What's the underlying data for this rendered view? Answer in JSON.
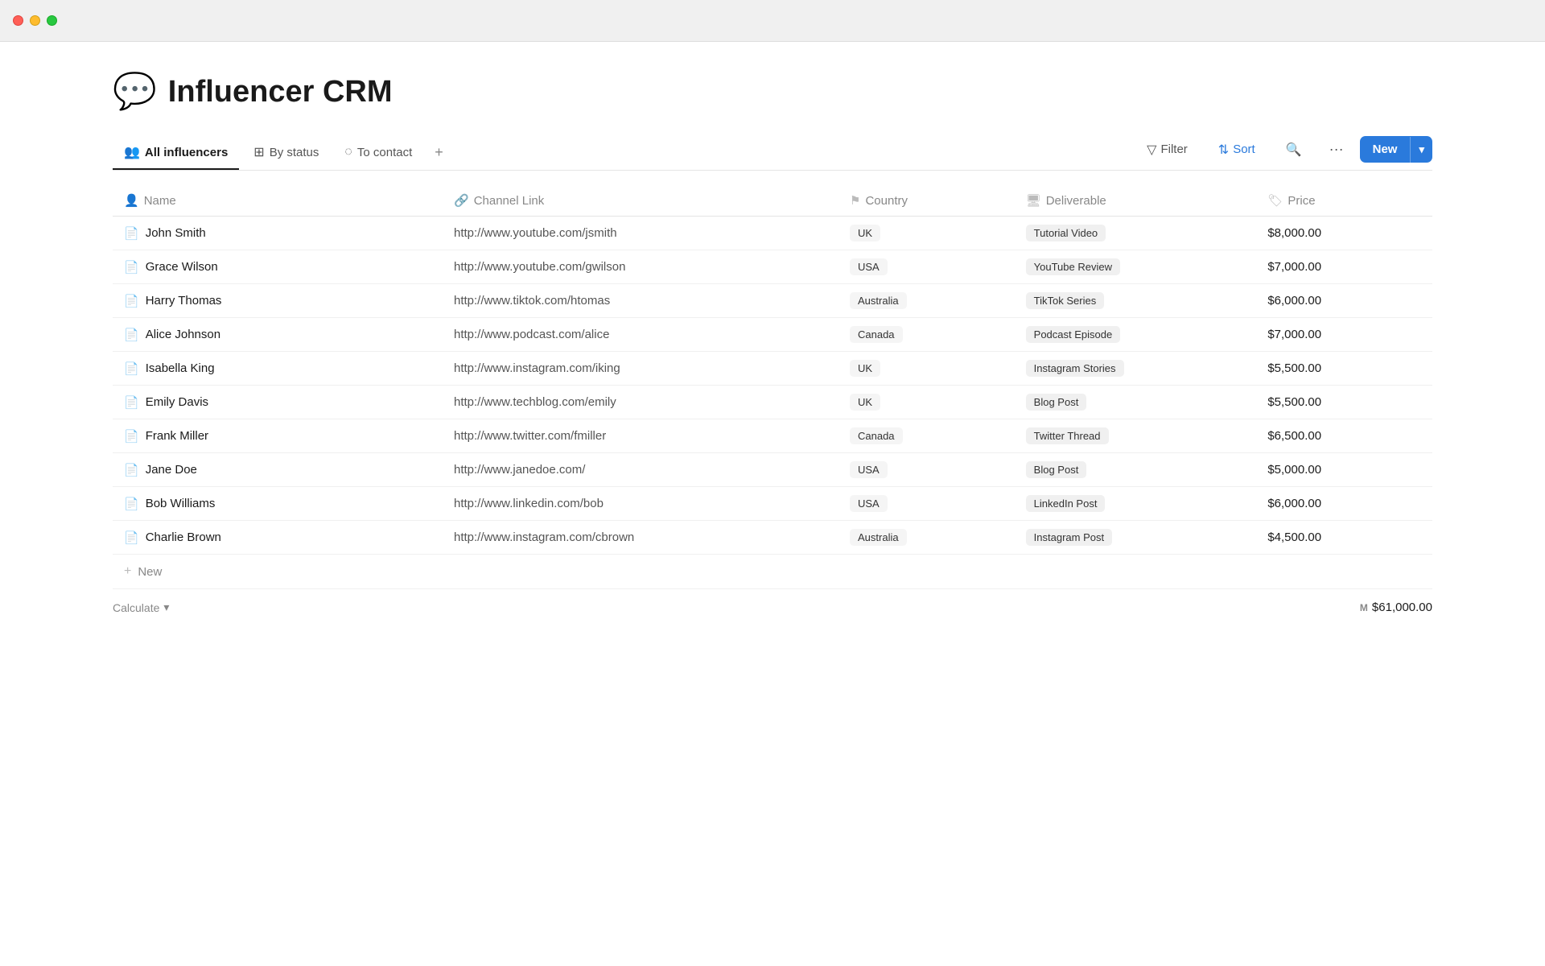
{
  "titlebar": {
    "traffic_lights": [
      "red",
      "yellow",
      "green"
    ]
  },
  "page": {
    "icon": "💬",
    "title": "Influencer CRM"
  },
  "tabs": [
    {
      "id": "all-influencers",
      "label": "All influencers",
      "icon": "👥",
      "active": true
    },
    {
      "id": "by-status",
      "label": "By status",
      "icon": "⊞",
      "active": false
    },
    {
      "id": "to-contact",
      "label": "To contact",
      "icon": "◌",
      "active": false
    }
  ],
  "tabs_add_label": "+",
  "toolbar": {
    "filter_label": "Filter",
    "sort_label": "Sort",
    "search_label": "Search",
    "more_label": "···",
    "new_label": "New",
    "new_arrow": "▾"
  },
  "table": {
    "columns": [
      {
        "id": "name",
        "label": "Name",
        "icon": "person"
      },
      {
        "id": "channel_link",
        "label": "Channel Link",
        "icon": "link"
      },
      {
        "id": "country",
        "label": "Country",
        "icon": "flag"
      },
      {
        "id": "deliverable",
        "label": "Deliverable",
        "icon": "box"
      },
      {
        "id": "price",
        "label": "Price",
        "icon": "tag"
      }
    ],
    "rows": [
      {
        "name": "John Smith",
        "link": "http://www.youtube.com/jsmith",
        "country": "UK",
        "deliverable": "Tutorial Video",
        "price": "$8,000.00"
      },
      {
        "name": "Grace Wilson",
        "link": "http://www.youtube.com/gwilson",
        "country": "USA",
        "deliverable": "YouTube Review",
        "price": "$7,000.00"
      },
      {
        "name": "Harry Thomas",
        "link": "http://www.tiktok.com/htomas",
        "country": "Australia",
        "deliverable": "TikTok Series",
        "price": "$6,000.00"
      },
      {
        "name": "Alice Johnson",
        "link": "http://www.podcast.com/alice",
        "country": "Canada",
        "deliverable": "Podcast Episode",
        "price": "$7,000.00"
      },
      {
        "name": "Isabella King",
        "link": "http://www.instagram.com/iking",
        "country": "UK",
        "deliverable": "Instagram Stories",
        "price": "$5,500.00"
      },
      {
        "name": "Emily Davis",
        "link": "http://www.techblog.com/emily",
        "country": "UK",
        "deliverable": "Blog Post",
        "price": "$5,500.00"
      },
      {
        "name": "Frank Miller",
        "link": "http://www.twitter.com/fmiller",
        "country": "Canada",
        "deliverable": "Twitter Thread",
        "price": "$6,500.00"
      },
      {
        "name": "Jane Doe",
        "link": "http://www.janedoe.com/",
        "country": "USA",
        "deliverable": "Blog Post",
        "price": "$5,000.00"
      },
      {
        "name": "Bob Williams",
        "link": "http://www.linkedin.com/bob",
        "country": "USA",
        "deliverable": "LinkedIn Post",
        "price": "$6,000.00"
      },
      {
        "name": "Charlie Brown",
        "link": "http://www.instagram.com/cbrown",
        "country": "Australia",
        "deliverable": "Instagram Post",
        "price": "$4,500.00"
      }
    ]
  },
  "footer": {
    "calculate_label": "Calculate",
    "calculate_arrow": "▾",
    "total_prefix": "M",
    "total": "$61,000.00"
  },
  "add_row_label": "New"
}
